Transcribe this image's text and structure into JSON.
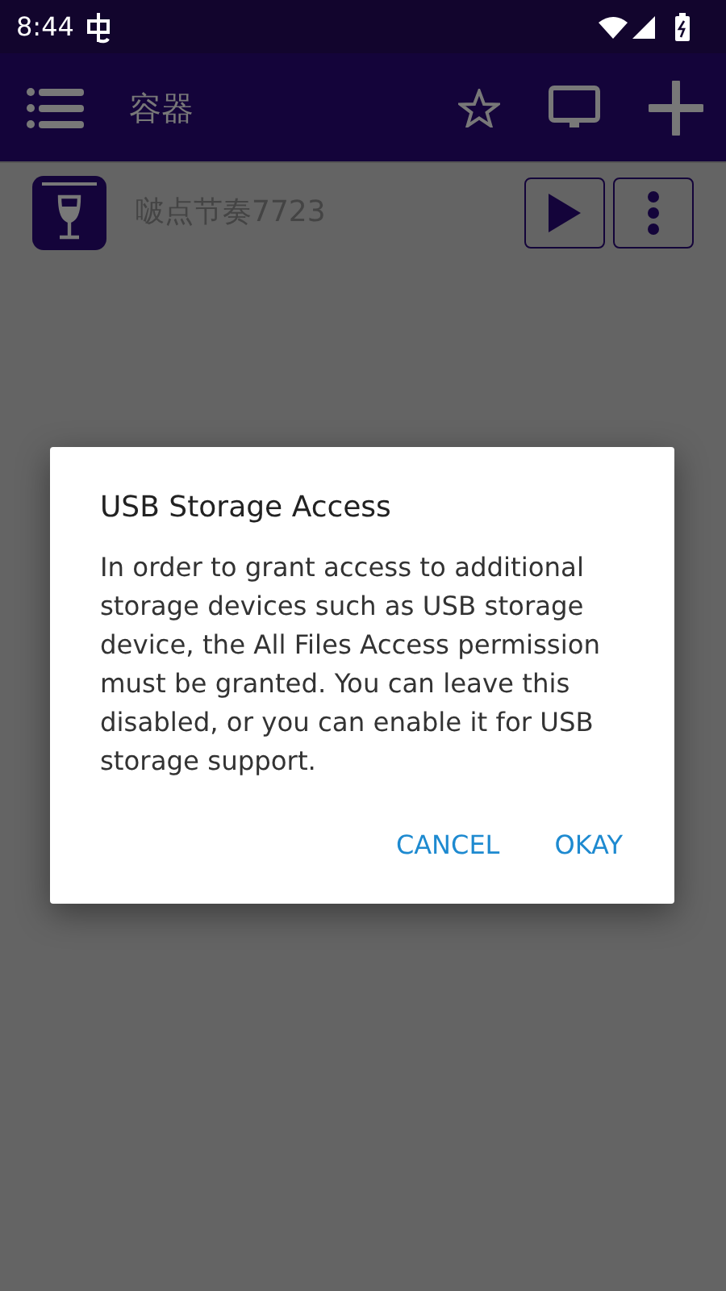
{
  "status_bar": {
    "time": "8:44"
  },
  "app_bar": {
    "title": "容器"
  },
  "containers": [
    {
      "name": "啵点节奏7723"
    }
  ],
  "dialog": {
    "title": "USB Storage Access",
    "message": "In order to grant access to additional storage devices such as USB storage device, the All Files Access permission must be granted. You can leave this disabled, or you can enable it for USB storage support.",
    "buttons": [
      "CANCEL",
      "OKAY"
    ]
  }
}
